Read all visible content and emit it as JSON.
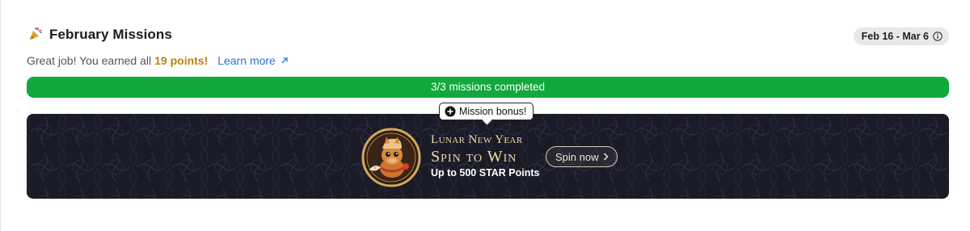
{
  "header": {
    "title": "February Missions",
    "date_range": "Feb 16 - Mar 6",
    "party_icon": "party-popper-icon",
    "info_icon": "info-icon"
  },
  "summary": {
    "prefix": "Great job! You earned all",
    "points": "19 points!",
    "learn_more": "Learn more"
  },
  "progress": {
    "label": "3/3 missions completed",
    "completed": 3,
    "total": 3,
    "color": "#10a53a"
  },
  "bonus_tag": {
    "label": "Mission bonus!"
  },
  "promo": {
    "line1": "Lunar New Year",
    "line2": "Spin to Win",
    "line3": "Up to 500 STAR Points",
    "button": "Spin now",
    "background": "#1a1b27",
    "accent": "#f3d9a6"
  }
}
